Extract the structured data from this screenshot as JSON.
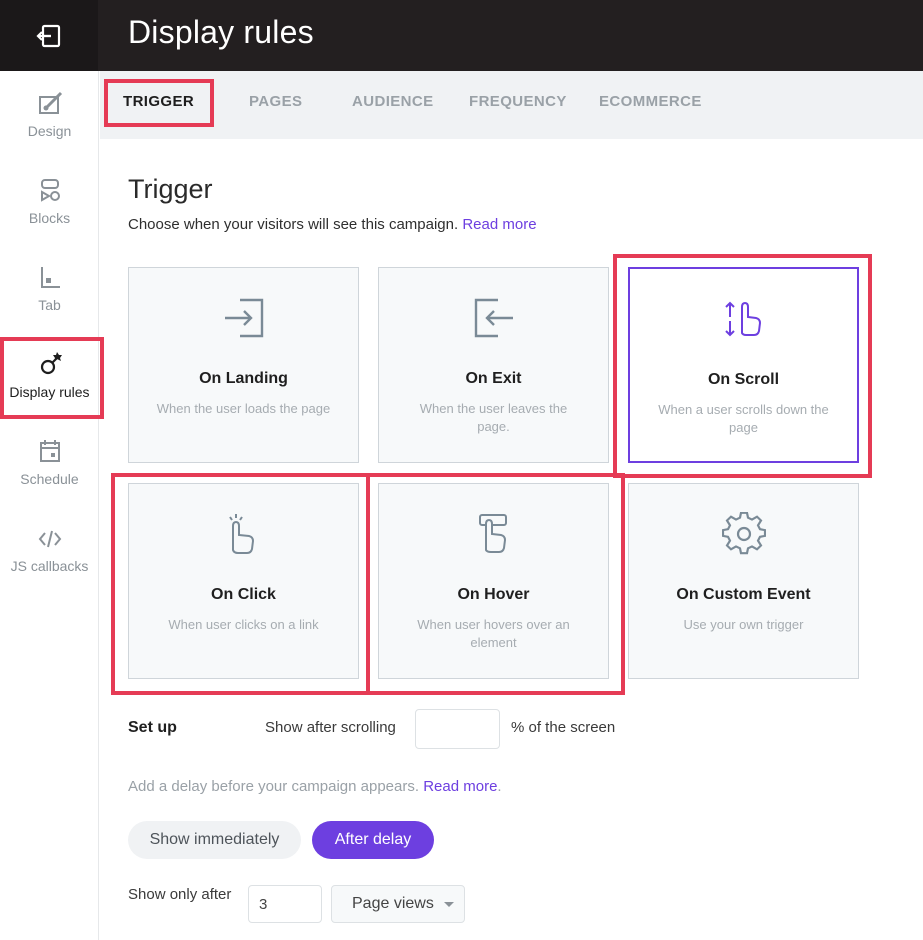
{
  "header": {
    "title": "Display rules"
  },
  "sidebar": {
    "items": [
      {
        "label": "Design",
        "icon": "brush-icon"
      },
      {
        "label": "Blocks",
        "icon": "blocks-icon"
      },
      {
        "label": "Tab",
        "icon": "tab-icon"
      },
      {
        "label": "Display rules",
        "icon": "display-rules-icon",
        "active": true
      },
      {
        "label": "Schedule",
        "icon": "calendar-icon"
      },
      {
        "label": "JS callbacks",
        "icon": "code-icon"
      }
    ]
  },
  "tabs": [
    {
      "label": "TRIGGER",
      "active": true
    },
    {
      "label": "PAGES"
    },
    {
      "label": "AUDIENCE"
    },
    {
      "label": "FREQUENCY"
    },
    {
      "label": "ECOMMERCE"
    }
  ],
  "trigger": {
    "title": "Trigger",
    "description": "Choose when your visitors will see this campaign.",
    "read_more": "Read more",
    "cards": [
      {
        "title": "On Landing",
        "desc": "When the user loads the page",
        "icon": "enter-icon"
      },
      {
        "title": "On Exit",
        "desc": "When the user leaves the page.",
        "icon": "exit-icon"
      },
      {
        "title": "On Scroll",
        "desc": "When a user scrolls down the page",
        "icon": "scroll-hand-icon",
        "selected": true
      },
      {
        "title": "On Click",
        "desc": "When user clicks on a link",
        "icon": "click-hand-icon"
      },
      {
        "title": "On Hover",
        "desc": "When user hovers over an element",
        "icon": "hover-hand-icon"
      },
      {
        "title": "On Custom Event",
        "desc": "Use your own trigger",
        "icon": "gear-icon"
      }
    ]
  },
  "setup": {
    "label": "Set up",
    "show_after_scrolling": "Show after scrolling",
    "scroll_value": "",
    "percent_label": "% of the screen",
    "delay_desc": "Add a delay before your campaign appears.",
    "delay_read_more": "Read more",
    "period": ".",
    "show_immediately": "Show immediately",
    "after_delay": "After delay",
    "show_only_after": "Show only after",
    "page_views_value": "3",
    "page_views_option": "Page views"
  },
  "colors": {
    "accent": "#6d3fe0",
    "highlight": "#e53b55",
    "header_bg": "#231f20"
  }
}
